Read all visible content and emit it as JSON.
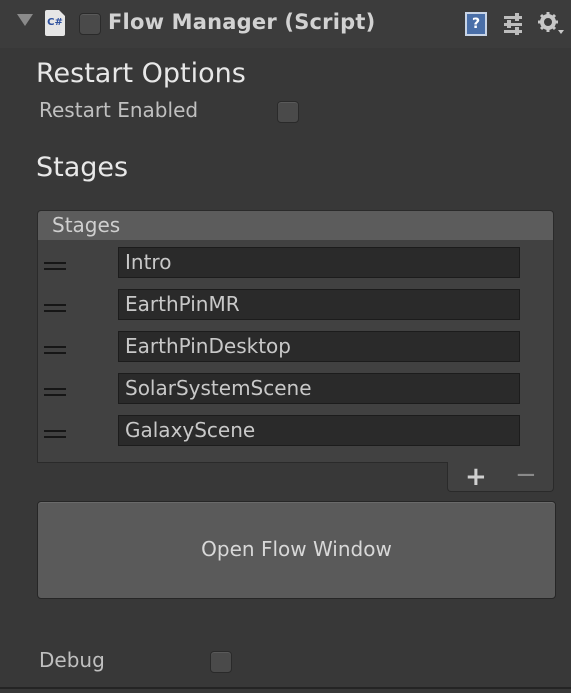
{
  "header": {
    "title": "Flow Manager (Script)",
    "script_icon_text": "C#",
    "help_icon_text": "?",
    "icons": [
      "foldout-arrow-icon",
      "csharp-script-icon",
      "help-icon",
      "preset-sliders-icon",
      "gear-icon"
    ]
  },
  "restart": {
    "heading": "Restart Options",
    "enabled_label": "Restart Enabled",
    "enabled_value": false
  },
  "stages_section": {
    "heading": "Stages"
  },
  "stages_list": {
    "header": "Stages",
    "items": [
      "Intro",
      "EarthPinMR",
      "EarthPinDesktop",
      "SolarSystemScene",
      "GalaxyScene"
    ],
    "add_label": "+",
    "remove_label": "−"
  },
  "open_button_label": "Open Flow Window",
  "debug": {
    "label": "Debug",
    "value": false
  },
  "colors": {
    "background": "#383838",
    "list_header": "#5c5c5c",
    "field_bg": "#2a2a2a",
    "button_bg": "#5a5a5a"
  }
}
